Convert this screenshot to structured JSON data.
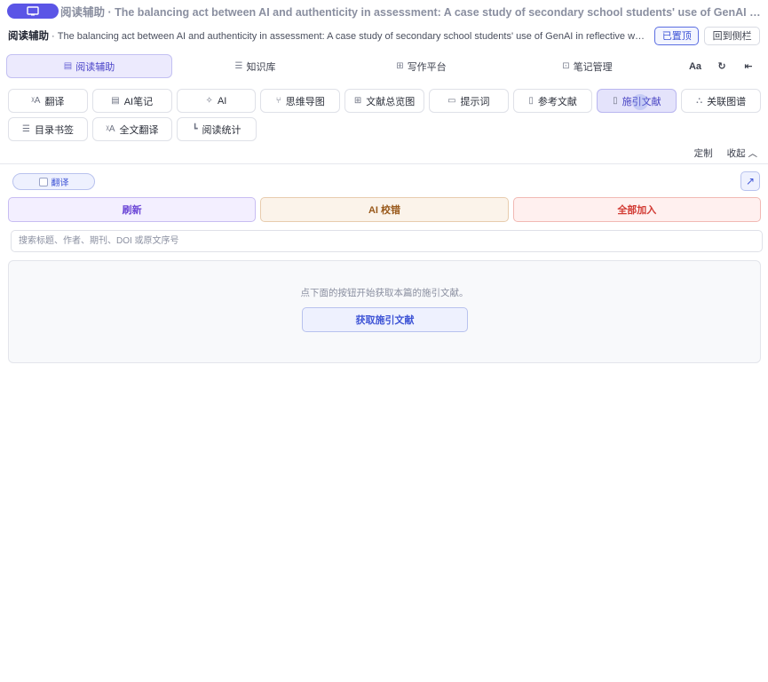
{
  "titlebar": {
    "text": "阅读辅助 · The balancing act between AI and authenticity in assessment: A case study of secondary school students' use of GenAI in reflective wr..."
  },
  "header": {
    "label": "阅读辅助",
    "title": " · The balancing act between AI and authenticity in assessment: A case study of secondary school students' use of GenAI in reflective wri...",
    "pin_label": "已置顶",
    "back_label": "回到侧栏"
  },
  "mainnav": {
    "tabs": [
      {
        "label": "阅读辅助",
        "icon": "document-icon"
      },
      {
        "label": "知识库",
        "icon": "database-icon"
      },
      {
        "label": "写作平台",
        "icon": "grid-icon"
      },
      {
        "label": "笔记管理",
        "icon": "folder-icon"
      }
    ],
    "font_label": "Aa"
  },
  "tools": {
    "row1": [
      {
        "label": "翻译",
        "icon": "translate-icon"
      },
      {
        "label": "AI笔记",
        "icon": "note-icon"
      },
      {
        "label": "AI",
        "icon": "sparkle-icon"
      },
      {
        "label": "思维导图",
        "icon": "mindmap-icon"
      },
      {
        "label": "文献总览图",
        "icon": "grid-icon"
      },
      {
        "label": "提示词",
        "icon": "chat-icon"
      },
      {
        "label": "参考文献",
        "icon": "document-icon"
      },
      {
        "label": "施引文献",
        "icon": "document-icon"
      },
      {
        "label": "关联图谱",
        "icon": "network-icon"
      }
    ],
    "row2": [
      {
        "label": "目录书签",
        "icon": "list-icon"
      },
      {
        "label": "全文翻译",
        "icon": "translate-icon"
      },
      {
        "label": "阅读统计",
        "icon": "bar-chart-icon"
      }
    ]
  },
  "controls": {
    "customize": "定制",
    "collapse": "收起"
  },
  "panel": {
    "translate_toggle": "翻译",
    "refresh": "刷新",
    "ai_check": "AI 校错",
    "add_all": "全部加入",
    "search_placeholder": "搜索标题、作者、期刊、DOI 或原文序号",
    "empty_text": "点下面的按钮开始获取本篇的施引文献。",
    "fetch_label": "获取施引文献"
  },
  "colors": {
    "accent": "#5b55e6",
    "refresh": "#6a45d6",
    "check": "#9a5a1c",
    "add_all": "#d23b34"
  }
}
